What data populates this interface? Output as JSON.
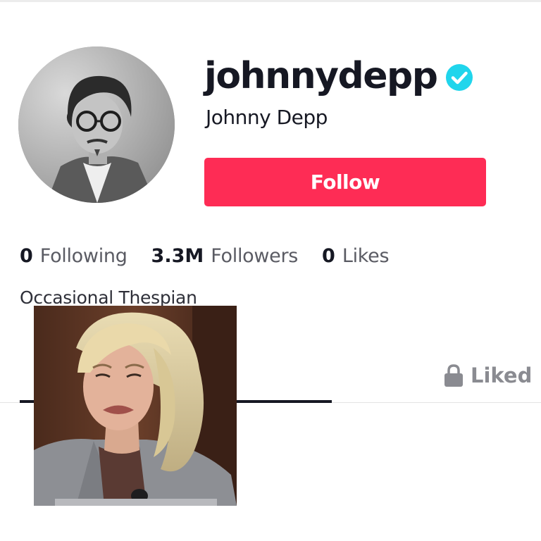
{
  "profile": {
    "username": "johnnydepp",
    "display_name": "Johnny Depp",
    "verified_icon": "verified-badge-icon",
    "verified_color": "#20d5ec",
    "avatar": "profile-avatar-photo"
  },
  "actions": {
    "follow_label": "Follow",
    "follow_color": "#fe2c55"
  },
  "stats": [
    {
      "value": "0",
      "label": "Following"
    },
    {
      "value": "3.3M",
      "label": "Followers"
    },
    {
      "value": "0",
      "label": "Likes"
    }
  ],
  "bio": "Occasional Thespian",
  "tabs": {
    "liked_label": "Liked",
    "liked_icon": "lock-icon"
  },
  "overlay": {
    "image": "overlaid-reaction-photo"
  }
}
